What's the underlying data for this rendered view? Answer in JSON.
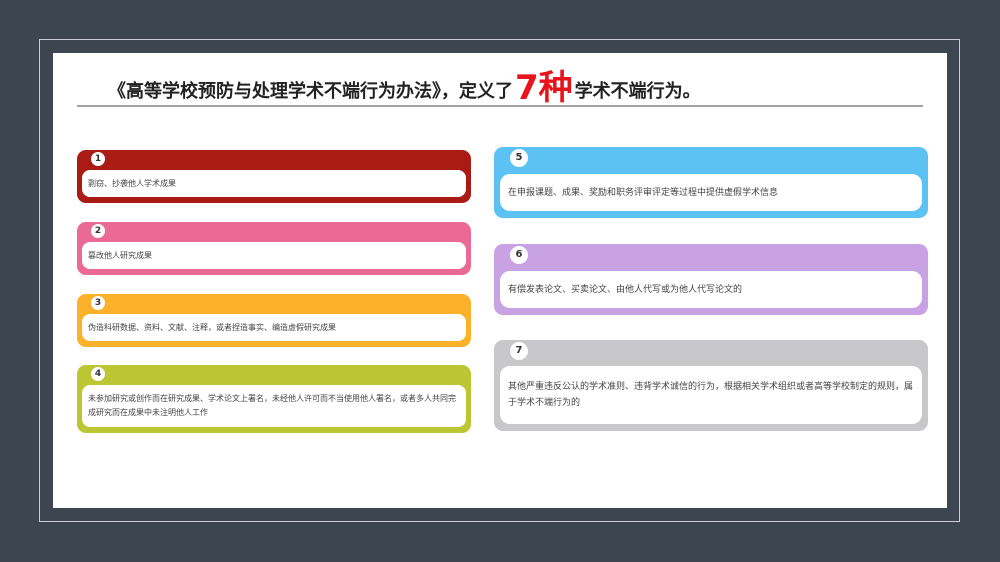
{
  "slide": {
    "title": {
      "prefix": "《高等学校预防与处理学术不端行为办法》，定义了",
      "number": "7种",
      "suffix": "学术不端行为。"
    },
    "colors": {
      "background": "#3d4550",
      "accent_number": "#e8141b",
      "card_1": "#a91b14",
      "card_2": "#ea6a95",
      "card_3": "#fbb12a",
      "card_4": "#bcc633",
      "card_5": "#5cc2f4",
      "card_6": "#c9a2e3",
      "card_7": "#c8c8ca"
    },
    "items": [
      {
        "num": "1",
        "text": "剽窃、抄袭他人学术成果"
      },
      {
        "num": "2",
        "text": "篡改他人研究成果"
      },
      {
        "num": "3",
        "text": "伪造科研数据、资料、文献、注释，或者捏造事实、编造虚假研究成果"
      },
      {
        "num": "4",
        "text": "未参加研究或创作而在研究成果、学术论文上署名，未经他人许可而不当使用他人署名，或者多人共同完成研究而在成果中未注明他人工作"
      },
      {
        "num": "5",
        "text": "在申报课题、成果、奖励和职务评审评定等过程中提供虚假学术信息"
      },
      {
        "num": "6",
        "text": "有偿发表论文、买卖论文、由他人代写或为他人代写论文的"
      },
      {
        "num": "7",
        "text": "其他严重违反公认的学术准则、违背学术诚信的行为，根据相关学术组织或者高等学校制定的规则，属于学术不端行为的"
      }
    ]
  }
}
